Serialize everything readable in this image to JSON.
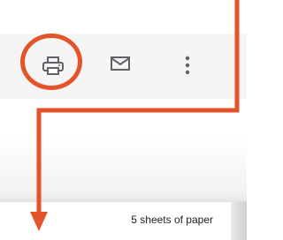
{
  "toolbar": {
    "print_icon": "printer-icon",
    "mail_icon": "envelope-icon",
    "more_icon": "more-vertical-icon"
  },
  "print_preview": {
    "sheets_count": "5 sheets of paper"
  },
  "colors": {
    "annotation": "#e4532a",
    "icon": "#5f6368",
    "toolbar_bg": "#f5f5f5"
  }
}
